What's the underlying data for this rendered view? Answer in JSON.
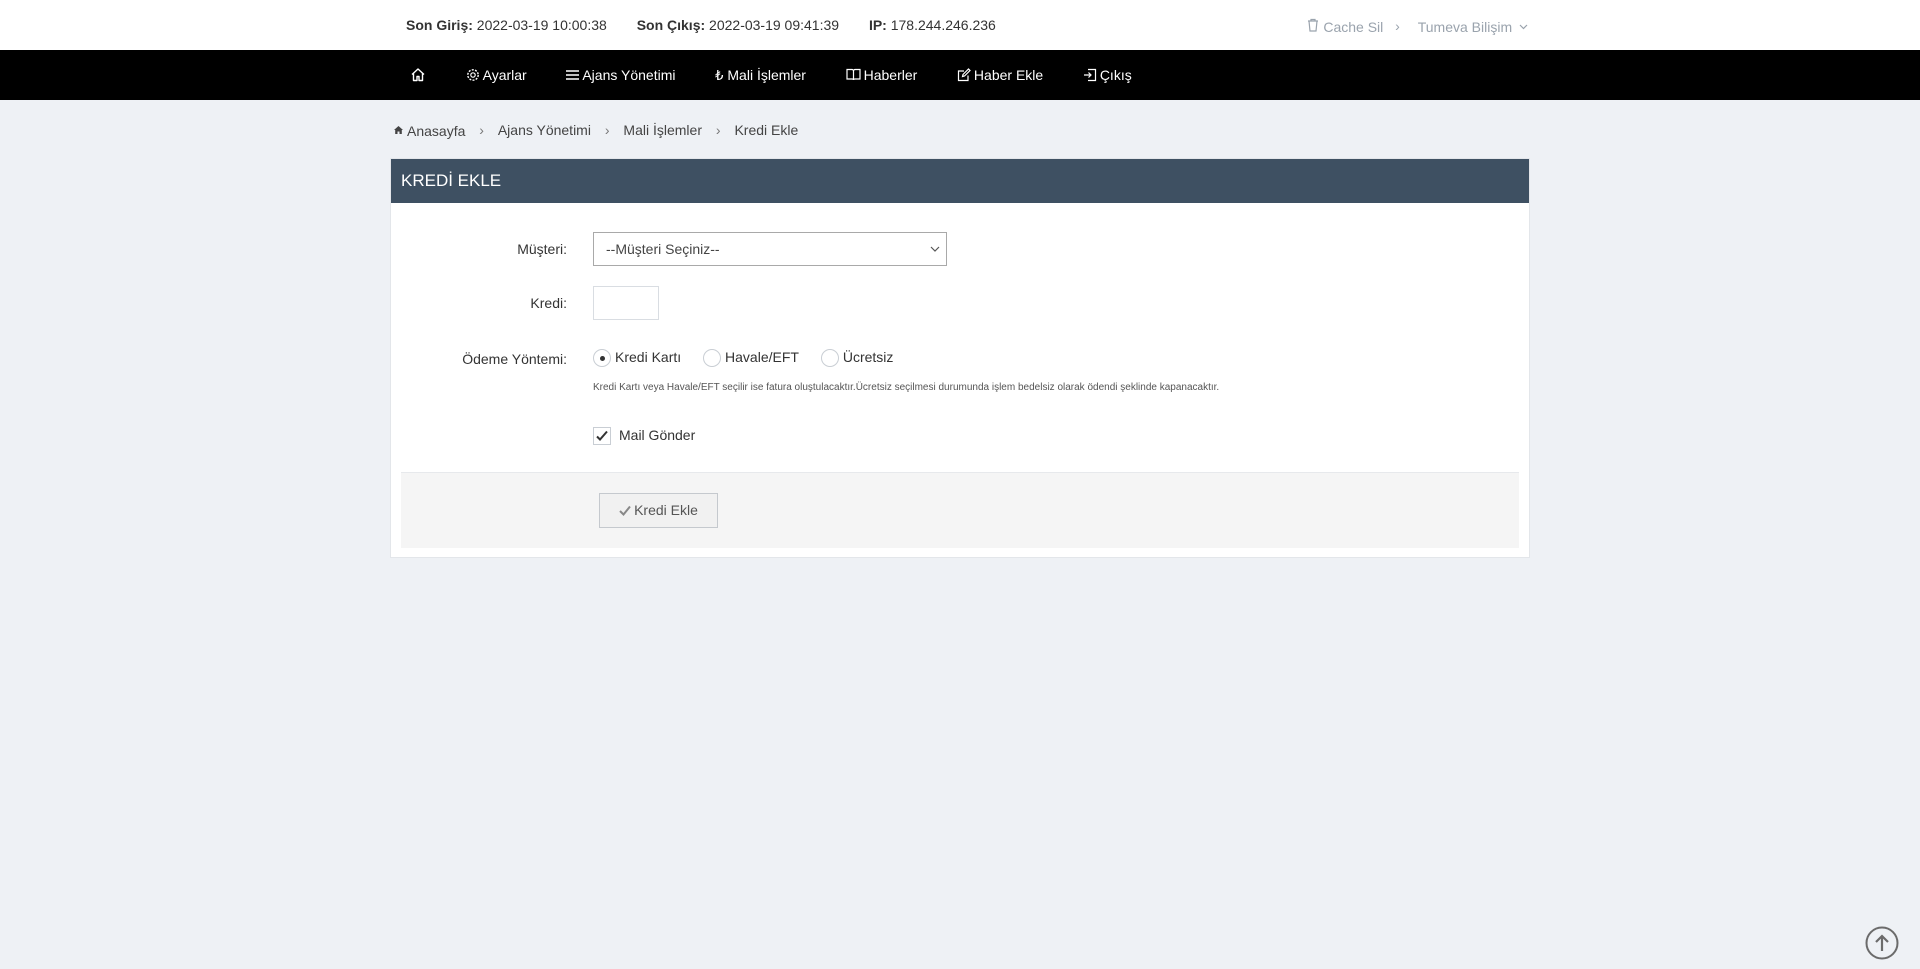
{
  "topbar": {
    "last_login_label": "Son Giriş:",
    "last_login_value": "2022-03-19 10:00:38",
    "last_logout_label": "Son Çıkış:",
    "last_logout_value": "2022-03-19 09:41:39",
    "ip_label": "IP:",
    "ip_value": "178.244.246.236",
    "cache_label": "Cache Sil",
    "user_label": "Tumeva Bilişim"
  },
  "nav": {
    "items": [
      {
        "label": "",
        "icon": "home-icon"
      },
      {
        "label": "Ayarlar",
        "icon": "gear-icon"
      },
      {
        "label": "Ajans Yönetimi",
        "icon": "list-icon"
      },
      {
        "label": "Mali İşlemler",
        "icon": "lira-icon"
      },
      {
        "label": "Haberler",
        "icon": "book-icon"
      },
      {
        "label": "Haber Ekle",
        "icon": "edit-icon"
      },
      {
        "label": "Çıkış",
        "icon": "sign-out-icon"
      }
    ]
  },
  "breadcrumb": {
    "items": [
      "Anasayfa",
      "Ajans Yönetimi",
      "Mali İşlemler",
      "Kredi Ekle"
    ]
  },
  "panel": {
    "title": "KREDİ EKLE"
  },
  "form": {
    "customer_label": "Müşteri:",
    "customer_selected": "--Müşteri Seçiniz--",
    "credit_label": "Kredi:",
    "credit_value": "",
    "payment_label": "Ödeme Yöntemi:",
    "payment_options": [
      "Kredi Kartı",
      "Havale/EFT",
      "Ücretsiz"
    ],
    "payment_selected": "Kredi Kartı",
    "payment_help": "Kredi Kartı veya Havale/EFT seçilir ise fatura oluştulacaktır.Ücretsiz seçilmesi durumunda işlem bedelsiz olarak ödendi şeklinde kapanacaktır.",
    "send_mail_label": "Mail Gönder",
    "send_mail_checked": true,
    "submit_label": "Kredi Ekle"
  },
  "colors": {
    "panel_header": "#3e5062",
    "navbar": "#000000",
    "background": "#eef1f5"
  }
}
